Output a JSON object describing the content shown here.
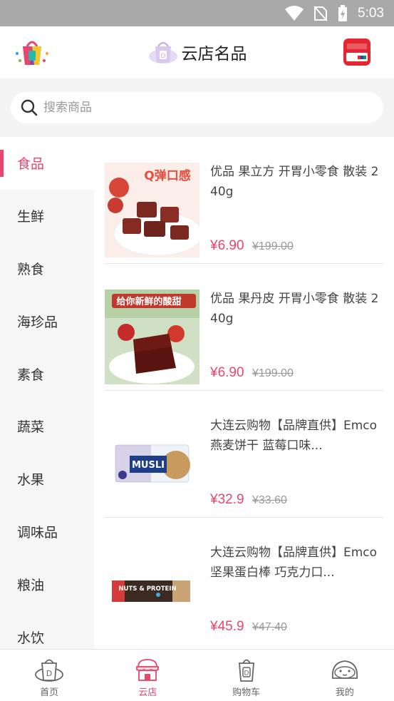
{
  "status_bar": {
    "time": "5:03"
  },
  "header": {
    "title": "云店名品"
  },
  "search": {
    "placeholder": "搜索商品"
  },
  "categories": [
    {
      "label": "食品",
      "active": true
    },
    {
      "label": "生鲜"
    },
    {
      "label": "熟食"
    },
    {
      "label": "海珍品"
    },
    {
      "label": "素食"
    },
    {
      "label": "蔬菜"
    },
    {
      "label": "水果"
    },
    {
      "label": "调味品"
    },
    {
      "label": "粮油"
    },
    {
      "label": "水饮"
    }
  ],
  "products": [
    {
      "name": "优品 果立方 开胃小零食 散装 240g",
      "price": "¥6.90",
      "original_price": "¥199.00",
      "image_text": "Q弹口感"
    },
    {
      "name": "优品 果丹皮 开胃小零食 散装 240g",
      "price": "¥6.90",
      "original_price": "¥199.00",
      "image_text": "给你新鲜的酸甜"
    },
    {
      "name": "大连云购物【品牌直供】Emco 燕麦饼干 蓝莓口味...",
      "price": "¥32.9",
      "original_price": "¥33.60",
      "image_text": "MUSLI"
    },
    {
      "name": "大连云购物【品牌直供】Emco 坚果蛋白棒 巧克力口...",
      "price": "¥45.9",
      "original_price": "¥47.40",
      "image_text": "NUTS & PROTEIN"
    }
  ],
  "tabbar": [
    {
      "label": "首页",
      "icon": "home-bag-icon"
    },
    {
      "label": "云店",
      "icon": "store-icon",
      "active": true
    },
    {
      "label": "购物车",
      "icon": "cart-bag-icon"
    },
    {
      "label": "我的",
      "icon": "profile-face-icon"
    }
  ],
  "colors": {
    "accent": "#e8466e",
    "status_bar": "#a9a9a9",
    "search_bg": "#f4f4f4",
    "sidebar_bg": "#f6f6f6"
  }
}
